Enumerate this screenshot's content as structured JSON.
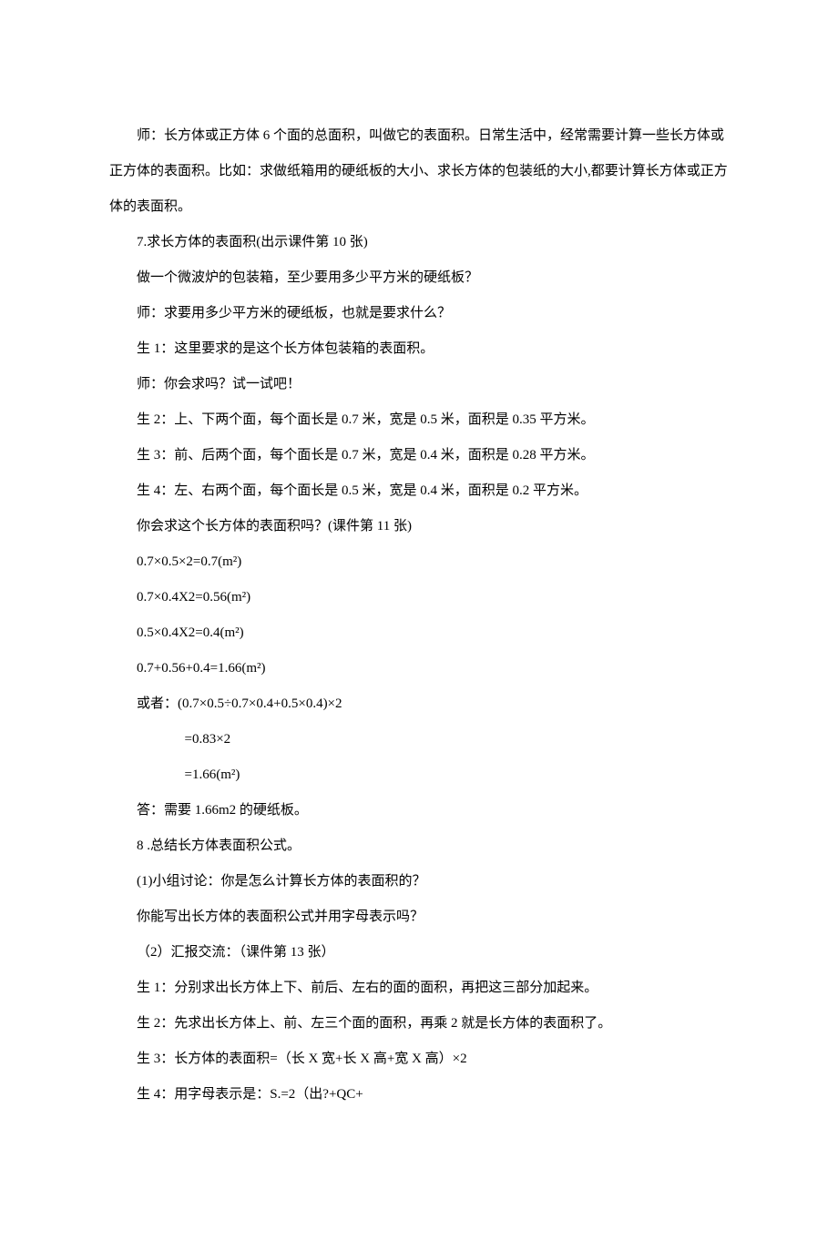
{
  "paragraphs": [
    "师：长方体或正方体 6 个面的总面积，叫做它的表面积。日常生活中，经常需要计算一些长方体或正方体的表面积。比如：求做纸箱用的硬纸板的大小、求长方体的包装纸的大小,都要计算长方体或正方体的表面积。",
    "7.求长方体的表面积(出示课件第 10 张)",
    "做一个微波炉的包装箱，至少要用多少平方米的硬纸板？",
    "师：求要用多少平方米的硬纸板，也就是要求什么？",
    "生 1：这里要求的是这个长方体包装箱的表面积。",
    "师：你会求吗？试一试吧！",
    "生 2：上、下两个面，每个面长是 0.7 米，宽是 0.5 米，面积是 0.35 平方米。",
    "生 3：前、后两个面，每个面长是 0.7 米，宽是 0.4 米，面积是 0.28 平方米。",
    "生 4：左、右两个面，每个面长是 0.5 米，宽是 0.4 米，面积是 0.2 平方米。",
    "你会求这个长方体的表面积吗？(课件第 11 张)",
    "0.7×0.5×2=0.7(m²)",
    "0.7×0.4X2=0.56(m²)",
    "0.5×0.4X2=0.4(m²)",
    "0.7+0.56+0.4=1.66(m²)",
    "或者：(0.7×0.5÷0.7×0.4+0.5×0.4)×2",
    "=0.83×2",
    "=1.66(m²)",
    "答：需要 1.66m2 的硬纸板。",
    "8 .总结长方体表面积公式。",
    "(1)小组讨论：你是怎么计算长方体的表面积的？",
    "你能写出长方体的表面积公式并用字母表示吗？",
    "（2）汇报交流：（课件第 13 张）",
    "生 1：分别求出长方体上下、前后、左右的面的面积，再把这三部分加起来。",
    "生 2：先求出长方体上、前、左三个面的面积，再乘 2 就是长方体的表面积了。",
    "生 3：长方体的表面积=（长 X 宽+长 X 高+宽 X 高）×2",
    "生 4：用字母表示是：S.=2（出?+QC+"
  ],
  "sub_indent_indexes": [
    15,
    16
  ]
}
